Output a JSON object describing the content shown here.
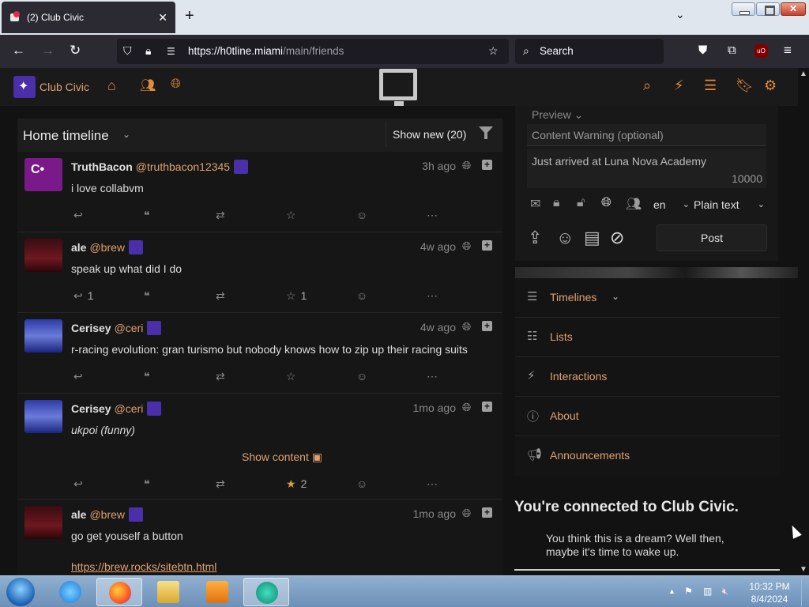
{
  "browser": {
    "tab_title": "(2) Club Civic",
    "tab_close": "✕",
    "new_tab": "+",
    "url_host": "https://h0tline.miami",
    "url_path": "/main/friends",
    "search_placeholder": "Search",
    "extension_badge": "uO"
  },
  "site": {
    "name": "Club Civic",
    "accent_color": "#e0a070"
  },
  "timeline": {
    "title": "Home timeline",
    "show_new": "Show new (20)",
    "statuses": [
      {
        "name": "TruthBacon",
        "handle": "@truthbacon12345",
        "time": "3h ago",
        "text": "i love collabvm",
        "reply_count": "",
        "fav_count": ""
      },
      {
        "name": "ale",
        "handle": "@brew",
        "time": "4w ago",
        "text": "speak up what did I do",
        "reply_count": "1",
        "fav_count": "1"
      },
      {
        "name": "Cerisey",
        "handle": "@ceri",
        "time": "4w ago",
        "text": "r-racing evolution: gran turismo but nobody knows how to zip up their racing suits",
        "reply_count": "",
        "fav_count": ""
      },
      {
        "name": "Cerisey",
        "handle": "@ceri",
        "time": "1mo ago",
        "text": "ukpoi (funny)",
        "show_content": "Show content",
        "reply_count": "",
        "fav_count": "2"
      },
      {
        "name": "ale",
        "handle": "@brew",
        "time": "1mo ago",
        "text": "go get youself a button",
        "link": "https://brew.rocks/sitebtn.html"
      }
    ]
  },
  "composer": {
    "preview_label": "Preview",
    "cw_placeholder": "Content Warning (optional)",
    "text_value": "Just arrived at Luna Nova Academy",
    "char_count": "10000",
    "language": "en",
    "content_type": "Plain text",
    "post_label": "Post"
  },
  "nav": {
    "items": [
      {
        "label": "Timelines"
      },
      {
        "label": "Lists"
      },
      {
        "label": "Interactions"
      },
      {
        "label": "About"
      },
      {
        "label": "Announcements"
      }
    ]
  },
  "instance": {
    "heading": "You're connected to Club Civic.",
    "blurb": "You think this is a dream? Well then, maybe it's time to wake up."
  },
  "taskbar": {
    "time": "10:32 PM",
    "date": "8/4/2024"
  }
}
